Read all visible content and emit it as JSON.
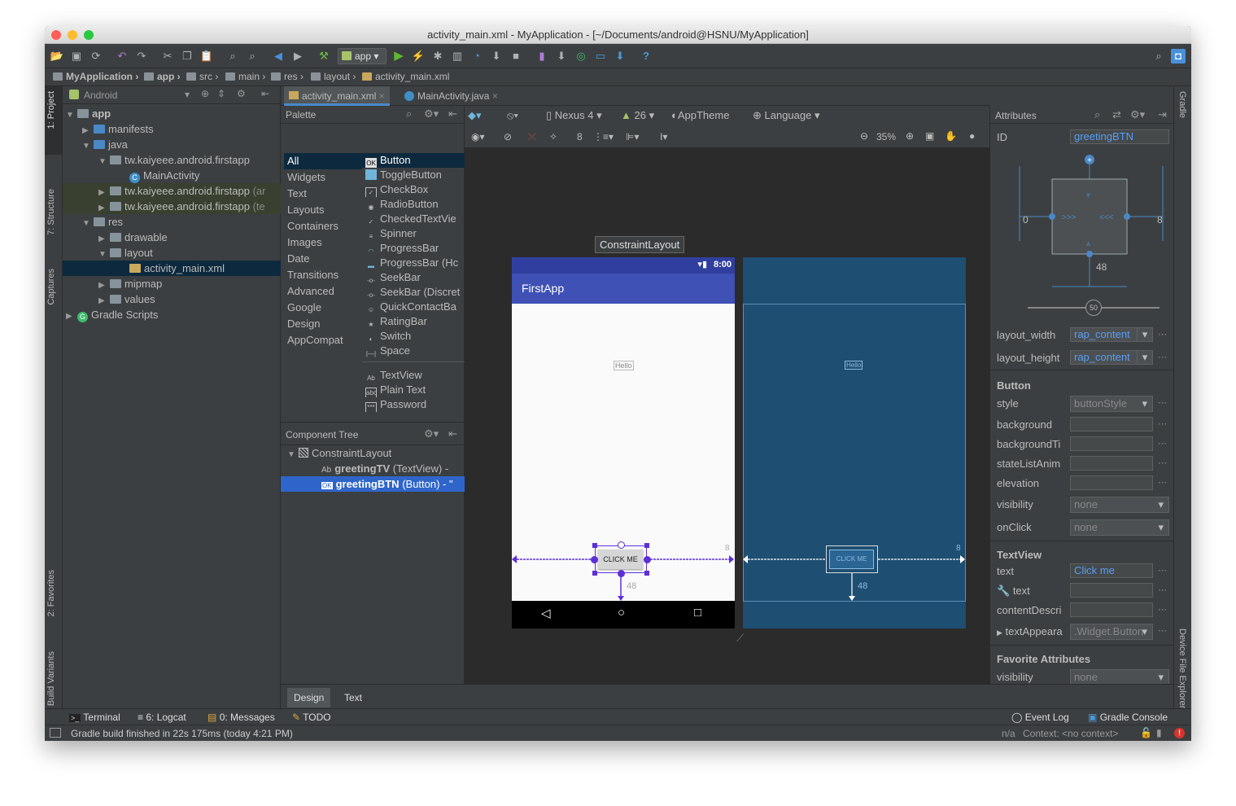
{
  "window": {
    "title": "activity_main.xml - MyApplication - [~/Documents/android@HSNU/MyApplication]"
  },
  "toolbar": {
    "run_config": "app"
  },
  "breadcrumb": [
    "MyApplication",
    "app",
    "src",
    "main",
    "res",
    "layout",
    "activity_main.xml"
  ],
  "left_tabs": [
    "1: Project",
    "7: Structure",
    "Captures",
    "2: Favorites",
    "Build Variants"
  ],
  "right_tabs": [
    "Gradle",
    "Device File Explorer"
  ],
  "project": {
    "view_mode": "Android",
    "tree": [
      {
        "label": "app",
        "bold": true
      },
      {
        "label": "manifests"
      },
      {
        "label": "java"
      },
      {
        "label": "tw.kaiyeee.android.firstapp"
      },
      {
        "label": "MainActivity"
      },
      {
        "label": "tw.kaiyeee.android.firstapp",
        "suffix": "(ar"
      },
      {
        "label": "tw.kaiyeee.android.firstapp",
        "suffix": "(te"
      },
      {
        "label": "res"
      },
      {
        "label": "drawable"
      },
      {
        "label": "layout"
      },
      {
        "label": "activity_main.xml"
      },
      {
        "label": "mipmap"
      },
      {
        "label": "values"
      },
      {
        "label": "Gradle Scripts"
      }
    ]
  },
  "editor_tabs": [
    {
      "label": "activity_main.xml",
      "active": true
    },
    {
      "label": "MainActivity.java",
      "active": false
    }
  ],
  "palette": {
    "title": "Palette",
    "categories": [
      "All",
      "Widgets",
      "Text",
      "Layouts",
      "Containers",
      "Images",
      "Date",
      "Transitions",
      "Advanced",
      "Google",
      "Design",
      "AppCompat"
    ],
    "items": [
      "Button",
      "ToggleButton",
      "CheckBox",
      "RadioButton",
      "CheckedTextVie",
      "Spinner",
      "ProgressBar",
      "ProgressBar (Hc",
      "SeekBar",
      "SeekBar (Discret",
      "QuickContactBa",
      "RatingBar",
      "Switch",
      "Space",
      "TextView",
      "Plain Text",
      "Password"
    ],
    "item_icons": [
      "OK",
      "",
      "✓",
      "◉",
      "✓",
      "≡",
      "◠",
      "▬",
      "-o-",
      "-o-",
      "☺",
      "★",
      "◐",
      "|—|",
      "Ab",
      "abc",
      "***"
    ]
  },
  "component_tree": {
    "title": "Component Tree",
    "root": "ConstraintLayout",
    "children": [
      {
        "name": "greetingTV",
        "type": "(TextView) -",
        "icon": "Ab"
      },
      {
        "name": "greetingBTN",
        "type": "(Button) - \"",
        "icon": "OK",
        "selected": true
      }
    ]
  },
  "design_toolbar": {
    "device": "Nexus 4",
    "api": "26",
    "theme": "AppTheme",
    "language": "Language",
    "margin": "8",
    "zoom": "35%"
  },
  "preview": {
    "tooltip": "ConstraintLayout",
    "status_time": "8:00",
    "app_title": "FirstApp",
    "textview": "Hello",
    "button": "CLICK ME",
    "margin_bottom": "48",
    "margin_right": "8"
  },
  "attributes": {
    "title": "Attributes",
    "id_label": "ID",
    "id_value": "greetingBTN",
    "constraint": {
      "left": "0",
      "right": "8",
      "bottom": "48",
      "bias": "50"
    },
    "layout_width": {
      "label": "layout_width",
      "value": "rap_content"
    },
    "layout_height": {
      "label": "layout_height",
      "value": "rap_content"
    },
    "button_section": "Button",
    "button_rows": [
      {
        "label": "style",
        "value": "buttonStyle",
        "kind": "select"
      },
      {
        "label": "background",
        "value": "",
        "kind": "field"
      },
      {
        "label": "backgroundTi",
        "value": "",
        "kind": "field"
      },
      {
        "label": "stateListAnim",
        "value": "",
        "kind": "field"
      },
      {
        "label": "elevation",
        "value": "",
        "kind": "field"
      },
      {
        "label": "visibility",
        "value": "none",
        "kind": "select"
      },
      {
        "label": "onClick",
        "value": "none",
        "kind": "select"
      }
    ],
    "textview_section": "TextView",
    "textview_rows": [
      {
        "label": "text",
        "value": "Click me",
        "kind": "field"
      },
      {
        "label": "text",
        "value": "",
        "kind": "field"
      },
      {
        "label": "contentDescri",
        "value": "",
        "kind": "field"
      },
      {
        "label": "textAppeara",
        "value": ".Widget.Button",
        "kind": "select"
      }
    ],
    "favorite_section": "Favorite Attributes",
    "favorite_rows": [
      {
        "label": "visibility",
        "value": "none",
        "kind": "select"
      }
    ]
  },
  "bottom_tabs": [
    "Design",
    "Text"
  ],
  "tool_windows": {
    "left": [
      "Terminal",
      "6: Logcat",
      "0: Messages",
      "TODO"
    ],
    "right": [
      "Event Log",
      "Gradle Console"
    ]
  },
  "status": {
    "message": "Gradle build finished in 22s 175ms (today 4:21 PM)",
    "na": "n/a",
    "context": "Context: <no context>"
  },
  "colors": {
    "accent": "#589df6",
    "appbar": "#3f51b5",
    "statusbar": "#303f9f",
    "blueprint": "#1e4e72",
    "constraint": "#5c2fd8"
  }
}
